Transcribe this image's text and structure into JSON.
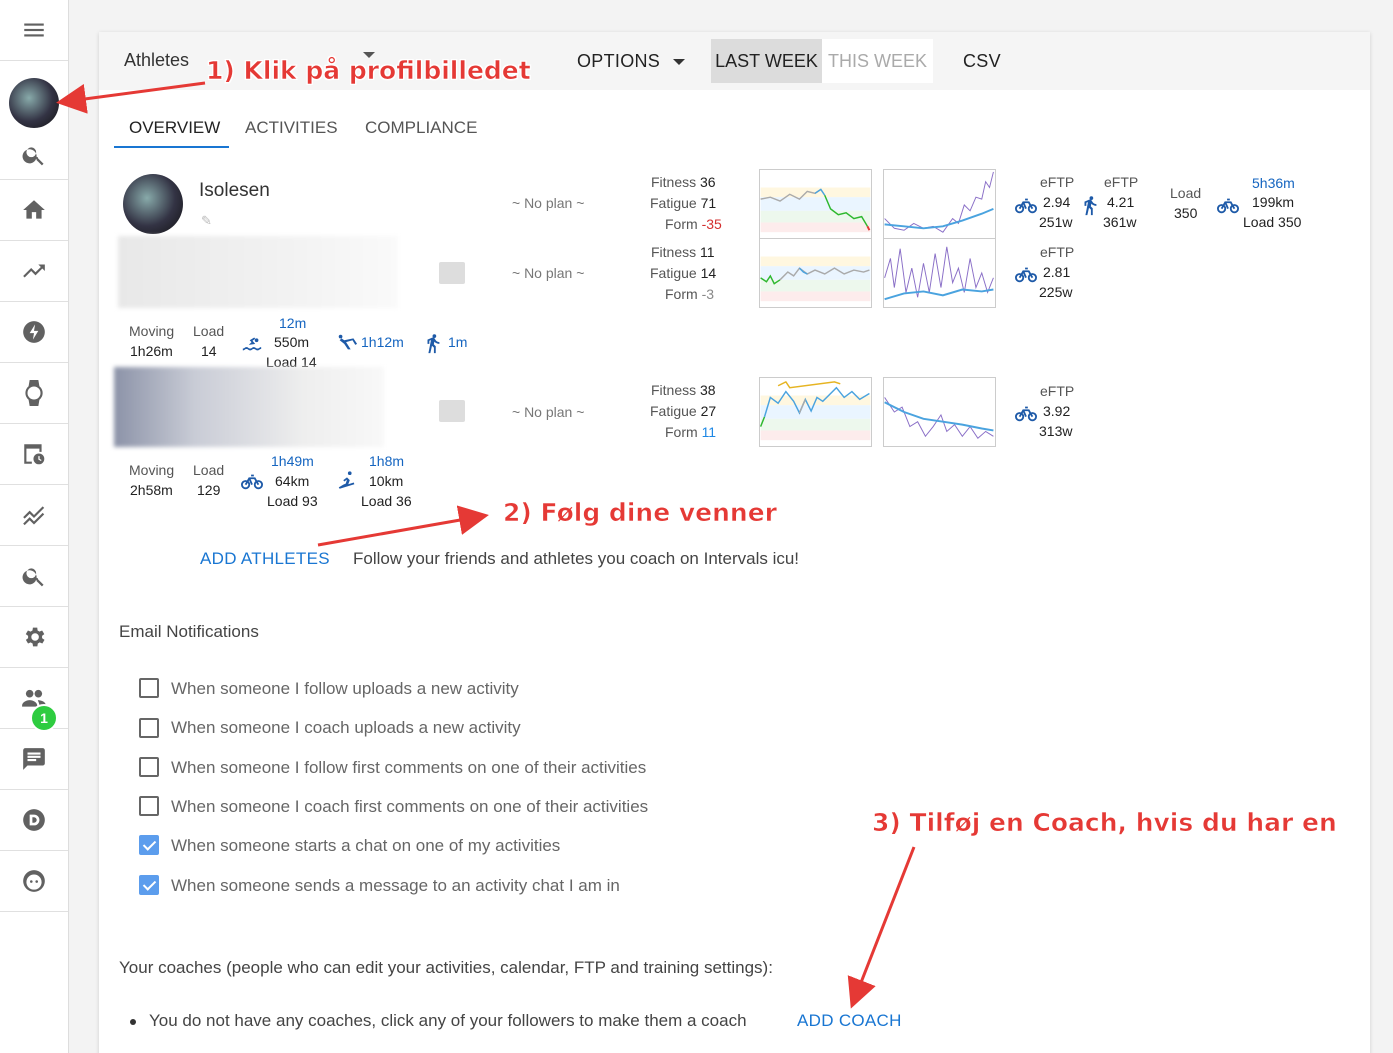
{
  "sidebar": {
    "badge_count": "1"
  },
  "topbar": {
    "title": "Athletes",
    "options_label": "OPTIONS",
    "last_week_label": "LAST WEEK",
    "this_week_label": "THIS WEEK",
    "csv_label": "CSV"
  },
  "tabs": [
    "OVERVIEW",
    "ACTIVITIES",
    "COMPLIANCE"
  ],
  "athletes": [
    {
      "name": "Isolesen",
      "plan": "~ No plan ~",
      "fitness_label": "Fitness",
      "fitness": "36",
      "fatigue_label": "Fatigue",
      "fatigue": "71",
      "form_label": "Form",
      "form": "-35",
      "eftp_label": "eFTP",
      "eftp_ride": "2.94",
      "eftp_ride_w": "251w",
      "eftp_run": "4.21",
      "eftp_run_w": "361w",
      "load_label": "Load",
      "load": "350",
      "ride_time": "5h36m",
      "ride_dist": "199km",
      "ride_load": "Load 350"
    },
    {
      "plan": "~ No plan ~",
      "fitness_label": "Fitness",
      "fitness": "11",
      "fatigue_label": "Fatigue",
      "fatigue": "14",
      "form_label": "Form",
      "form": "-3",
      "eftp_label": "eFTP",
      "eftp_ride": "2.81",
      "eftp_ride_w": "225w",
      "moving_label": "Moving",
      "moving": "1h26m",
      "load_label": "Load",
      "load": "14",
      "swim_time": "12m",
      "swim_dist": "550m",
      "swim_load": "Load 14",
      "other_time": "1h12m",
      "run_time": "1m"
    },
    {
      "plan": "~ No plan ~",
      "fitness_label": "Fitness",
      "fitness": "38",
      "fatigue_label": "Fatigue",
      "fatigue": "27",
      "form_label": "Form",
      "form": "11",
      "eftp_label": "eFTP",
      "eftp_ride": "3.92",
      "eftp_ride_w": "313w",
      "moving_label": "Moving",
      "moving": "2h58m",
      "load_label": "Load",
      "load": "129",
      "ride_time": "1h49m",
      "ride_dist": "64km",
      "ride_load": "Load 93",
      "ski_time": "1h8m",
      "ski_dist": "10km",
      "ski_load": "Load 36"
    }
  ],
  "add_athletes": {
    "label": "ADD ATHLETES",
    "text": "Follow your friends and athletes you coach on Intervals icu!"
  },
  "email": {
    "heading": "Email Notifications",
    "options": [
      {
        "label": "When someone I follow uploads a new activity",
        "checked": false
      },
      {
        "label": "When someone I coach uploads a new activity",
        "checked": false
      },
      {
        "label": "When someone I follow first comments on one of their activities",
        "checked": false
      },
      {
        "label": "When someone I coach first comments on one of their activities",
        "checked": false
      },
      {
        "label": "When someone starts a chat on one of my activities",
        "checked": true
      },
      {
        "label": "When someone sends a message to an activity chat I am in",
        "checked": true
      }
    ]
  },
  "coaches": {
    "heading": "Your coaches (people who can edit your activities, calendar, FTP and training settings):",
    "none_text": "You do not have any coaches, click any of your followers to make them a coach",
    "add_label": "ADD COACH"
  },
  "annotations": {
    "a1": "1) Klik på profilbilledet",
    "a2": "2) Følg dine venner",
    "a3": "3) Tilføj en Coach, hvis du har en"
  },
  "colors": {
    "accent": "#1976d2",
    "annotation": "#e53935",
    "badge": "#2ecc40",
    "negative": "#d32f2f"
  }
}
